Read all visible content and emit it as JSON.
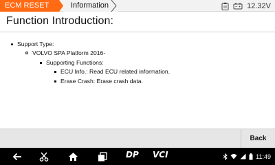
{
  "header": {
    "tab_module": "ECM RESET",
    "tab_page": "Information",
    "voltage": "12.32V"
  },
  "page": {
    "title": "Function Introduction:"
  },
  "content": {
    "support_type_label": "Support Type:",
    "platform": "VOLVO SPA Platform 2016-",
    "supporting_functions_label": "Supporting Functions:",
    "functions": [
      "ECU Info.: Read ECU related information.",
      "Erase Crash: Erase crash data."
    ]
  },
  "footer": {
    "back_label": "Back"
  },
  "system_nav": {
    "dp_label": "DP",
    "vci_label": "VCI",
    "time": "11:49"
  },
  "colors": {
    "accent": "#ff6a13",
    "nav_background": "#000000"
  },
  "icons": [
    "clipboard-icon",
    "battery-icon",
    "back-arrow-icon",
    "scissors-icon",
    "home-icon",
    "recent-apps-icon",
    "bluetooth-icon",
    "wifi-icon",
    "signal-icon",
    "battery-status-icon"
  ]
}
